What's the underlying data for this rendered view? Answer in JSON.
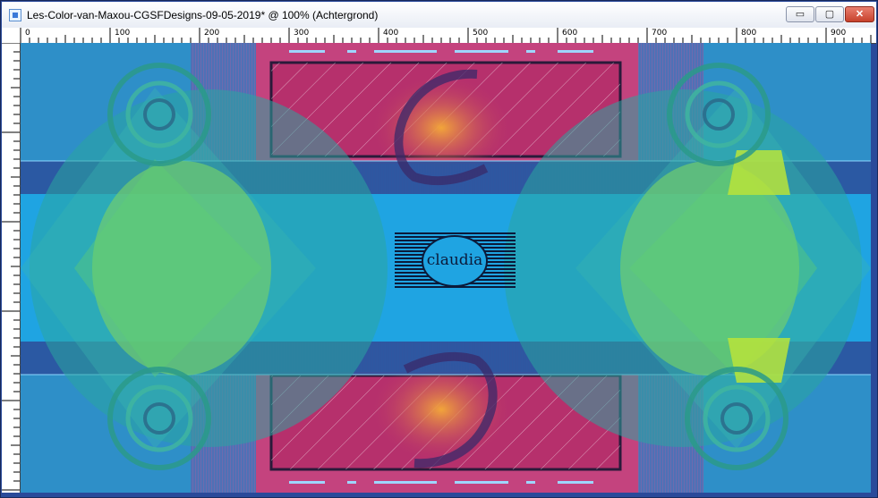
{
  "window": {
    "title": "Les-Color-van-Maxou-CGSFDesigns-09-05-2019* @ 100% (Achtergrond)",
    "controls": {
      "minimize": "▭",
      "maximize": "▢",
      "close": "✕"
    }
  },
  "ruler": {
    "labels": [
      "0",
      "100",
      "200",
      "300",
      "400",
      "500",
      "600",
      "700",
      "800",
      "900"
    ]
  },
  "canvas": {
    "watermark_text": "claudia",
    "colors": {
      "background": "#2e8fc8",
      "band_dark": "#2b55a0",
      "band_light": "#1fa4e2",
      "pink": "#b6306c",
      "green": "#8ed84a",
      "lime": "#b9e43a",
      "teal": "#2aa6a0"
    }
  }
}
